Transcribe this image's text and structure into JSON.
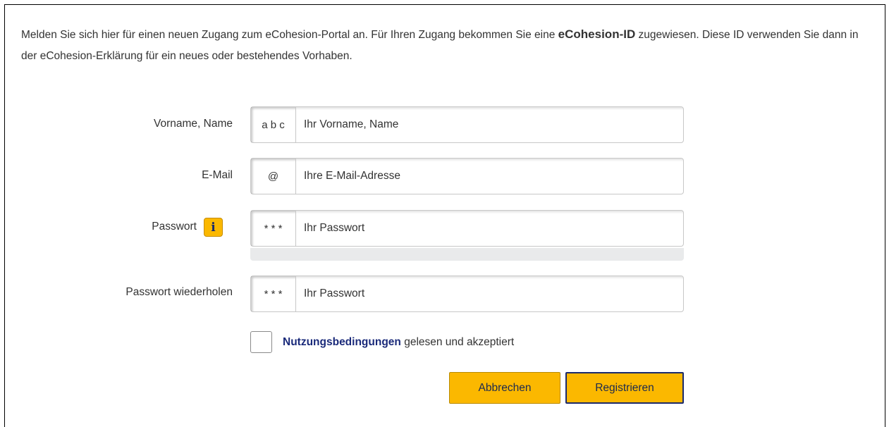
{
  "intro": {
    "text_before": "Melden Sie sich hier für einen neuen Zugang zum eCohesion-Portal an. Für Ihren Zugang bekommen Sie eine ",
    "id_label": "eCohesion-ID",
    "text_after": " zugewiesen. Diese ID verwenden Sie dann in der eCohesion-Erklärung für ein neues oder bestehendes Vorhaben."
  },
  "form": {
    "name": {
      "label": "Vorname, Name",
      "addon": "a b c",
      "placeholder": "Ihr Vorname, Name",
      "value": ""
    },
    "email": {
      "label": "E-Mail",
      "addon": "@",
      "placeholder": "Ihre E-Mail-Adresse",
      "value": ""
    },
    "password": {
      "label": "Passwort",
      "addon": "* * *",
      "placeholder": "Ihr Passwort",
      "value": "",
      "info_icon": "info-icon"
    },
    "password_repeat": {
      "label": "Passwort wiederholen",
      "addon": "* * *",
      "placeholder": "Ihr Passwort",
      "value": ""
    },
    "terms": {
      "link_text": "Nutzungsbedingungen",
      "text": " gelesen und akzeptiert",
      "checked": false
    }
  },
  "buttons": {
    "cancel_label": "Abbrechen",
    "register_label": "Registrieren"
  },
  "colors": {
    "accent": "#fbb800",
    "link": "#1a2a7a",
    "text": "#333333"
  }
}
